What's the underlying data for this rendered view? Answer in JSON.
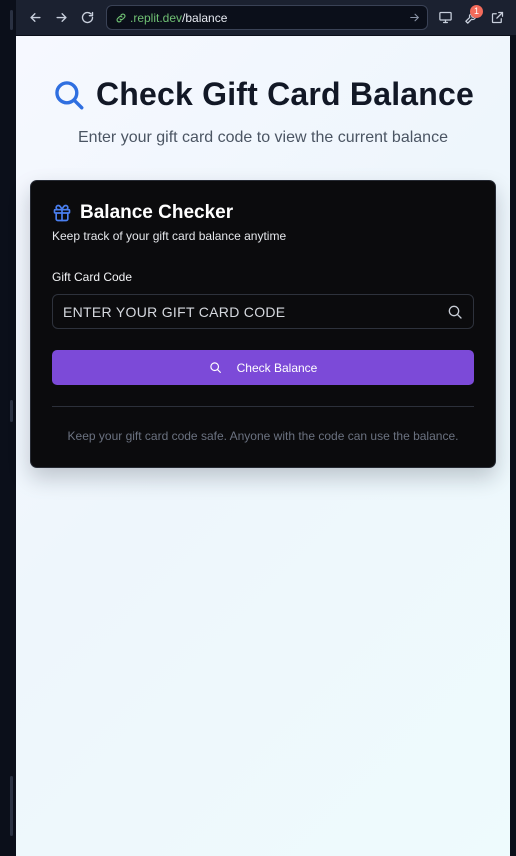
{
  "browser": {
    "url_domain": ".replit.dev",
    "url_path": "/balance",
    "notification_count": "1"
  },
  "page": {
    "title": "Check Gift Card Balance",
    "subtitle": "Enter your gift card code to view the current balance"
  },
  "card": {
    "title": "Balance Checker",
    "description": "Keep track of your gift card balance anytime",
    "field_label": "Gift Card Code",
    "input_placeholder": "Enter your gift card code",
    "input_value": "",
    "button_label": "Check Balance",
    "footnote": "Keep your gift card code safe. Anyone with the code can use the balance."
  },
  "colors": {
    "accent": "#7c4ad8",
    "title_icon": "#2f6fe0",
    "url_domain": "#6fbf73"
  },
  "icons": {
    "title": "search-icon",
    "card": "gift-icon",
    "input": "search-icon",
    "button": "search-icon"
  }
}
